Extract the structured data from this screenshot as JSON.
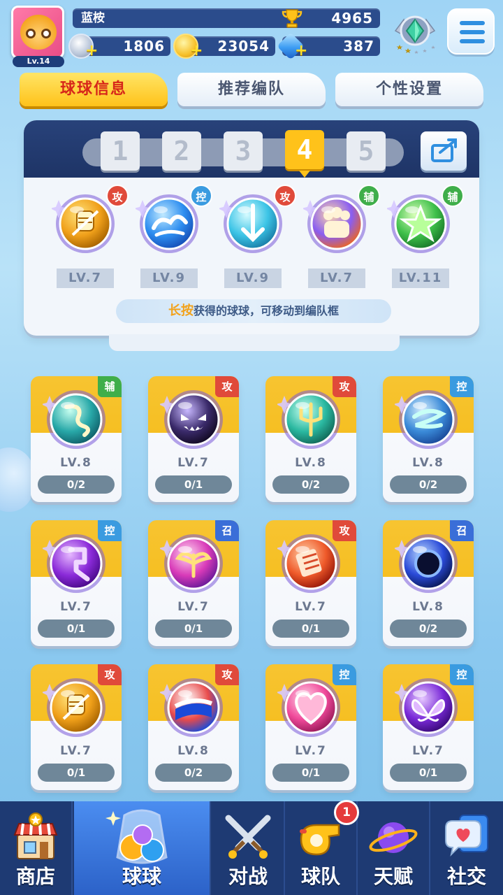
{
  "player": {
    "name": "蓝桉",
    "level": "Lv.14",
    "trophies": "4965",
    "currency_silver": "1806",
    "currency_gold": "23054",
    "currency_gem": "387"
  },
  "tabs": [
    {
      "label": "球球信息",
      "active": true
    },
    {
      "label": "推荐编队",
      "active": false
    },
    {
      "label": "个性设置",
      "active": false
    }
  ],
  "team": {
    "slots": [
      "1",
      "2",
      "3",
      "4",
      "5"
    ],
    "selected_slot": "4",
    "balls": [
      {
        "tag": "攻",
        "type": "atk",
        "level": "LV.7",
        "icon": "golden-knight-orb"
      },
      {
        "tag": "控",
        "type": "ctl",
        "level": "LV.9",
        "icon": "cloud-swirl-orb"
      },
      {
        "tag": "攻",
        "type": "atk",
        "level": "LV.9",
        "icon": "ice-arrow-orb"
      },
      {
        "tag": "辅",
        "type": "sup",
        "level": "LV.7",
        "icon": "crowd-orb"
      },
      {
        "tag": "辅",
        "type": "sup",
        "level": "LV.11",
        "icon": "green-star-orb"
      }
    ],
    "hint_highlight": "长按",
    "hint_text": "获得的球球，可移动到编队框"
  },
  "collection": [
    {
      "tag": "辅",
      "type": "sup",
      "level": "LV.8",
      "count": "0/2",
      "icon": "dragon-orb"
    },
    {
      "tag": "攻",
      "type": "atk",
      "level": "LV.7",
      "count": "0/1",
      "icon": "venom-face-orb"
    },
    {
      "tag": "攻",
      "type": "atk",
      "level": "LV.8",
      "count": "0/2",
      "icon": "trident-orb"
    },
    {
      "tag": "控",
      "type": "ctl",
      "level": "LV.8",
      "count": "0/2",
      "icon": "wind-swirl-orb"
    },
    {
      "tag": "控",
      "type": "ctl",
      "level": "LV.7",
      "count": "0/1",
      "icon": "purple-hook-orb"
    },
    {
      "tag": "召",
      "type": "sum",
      "level": "LV.7",
      "count": "0/1",
      "icon": "phoenix-orb"
    },
    {
      "tag": "攻",
      "type": "atk",
      "level": "LV.7",
      "count": "0/1",
      "icon": "fire-scroll-orb"
    },
    {
      "tag": "召",
      "type": "sum",
      "level": "LV.8",
      "count": "0/2",
      "icon": "black-hole-orb"
    },
    {
      "tag": "攻",
      "type": "atk",
      "level": "LV.7",
      "count": "0/1",
      "icon": "golden-knight-orb"
    },
    {
      "tag": "攻",
      "type": "atk",
      "level": "LV.8",
      "count": "0/2",
      "icon": "pepsi-orb"
    },
    {
      "tag": "控",
      "type": "ctl",
      "level": "LV.7",
      "count": "0/1",
      "icon": "heart-orb"
    },
    {
      "tag": "控",
      "type": "ctl",
      "level": "LV.7",
      "count": "0/1",
      "icon": "butterfly-orb"
    }
  ],
  "nav": [
    {
      "label": "商店",
      "icon": "shop-icon"
    },
    {
      "label": "球球",
      "icon": "ball-jar-icon",
      "active": true
    },
    {
      "label": "对战",
      "icon": "crossed-swords-icon"
    },
    {
      "label": "球队",
      "icon": "whistle-icon",
      "badge": "1"
    },
    {
      "label": "天赋",
      "icon": "planet-icon"
    },
    {
      "label": "社交",
      "icon": "chat-heart-icon"
    }
  ],
  "colors": {
    "active_tab": "#ffc21a",
    "attack": "#e04a3a",
    "control": "#3a9be0",
    "support": "#3fae4a",
    "summon": "#3a6ed8",
    "nav_bg": "#1e3a73"
  }
}
